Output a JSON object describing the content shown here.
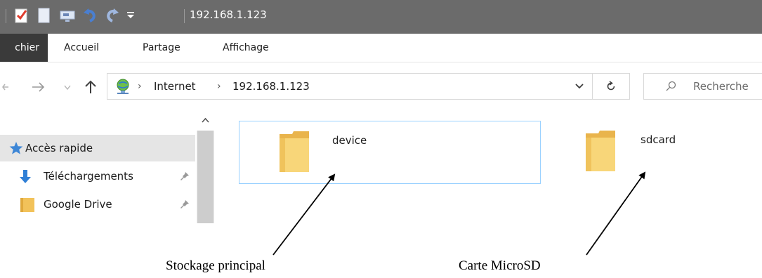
{
  "titlebar": {
    "title": "192.168.1.123"
  },
  "ribbon": {
    "tabs": [
      "chier",
      "Accueil",
      "Partage",
      "Affichage"
    ]
  },
  "address": {
    "crumbs": [
      "Internet",
      "192.168.1.123"
    ],
    "search_placeholder": "Recherche"
  },
  "navpane": {
    "items": [
      {
        "label": "Accès rapide",
        "icon": "star-icon",
        "pinned": false
      },
      {
        "label": "Téléchargements",
        "icon": "download-arrow-icon",
        "pinned": true
      },
      {
        "label": "Google Drive",
        "icon": "folder-icon",
        "pinned": true
      }
    ]
  },
  "content": {
    "items": [
      {
        "label": "device",
        "icon": "folder-icon"
      },
      {
        "label": "sdcard",
        "icon": "folder-icon"
      }
    ]
  },
  "annotations": {
    "captions": [
      "Stockage principal",
      "Carte MicroSD"
    ]
  },
  "colors": {
    "titlebar": "#6b6b6b",
    "file_tab": "#3a3a3a",
    "selection_border": "#99d1ff",
    "selected_nav": "#e5e5e5",
    "folder": "#f4c95d"
  }
}
